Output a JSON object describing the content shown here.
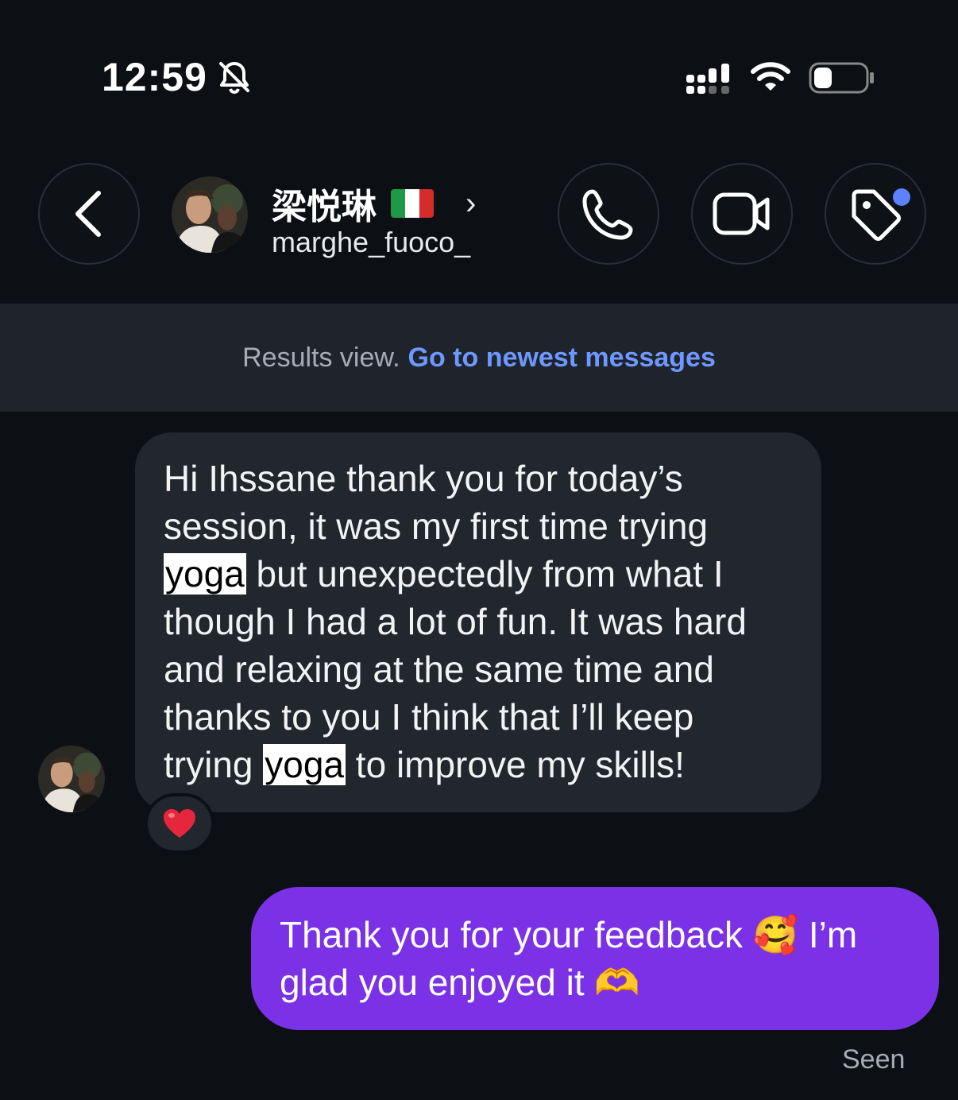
{
  "status_bar": {
    "time": "12:59",
    "icons": [
      "bell-slash-icon",
      "cellular-signal-icon",
      "wifi-icon",
      "battery-icon"
    ]
  },
  "header": {
    "contact_name": "梁悦琳",
    "username": "marghe_fuoco_",
    "flag": "italy-flag",
    "buttons": [
      "back-button",
      "call-button",
      "video-call-button",
      "tag-button"
    ],
    "accent_dot_color": "#5b82ff"
  },
  "banner": {
    "prefix": "Results view.",
    "link": "Go to newest messages",
    "link_color": "#6f98ff"
  },
  "messages": [
    {
      "direction": "incoming",
      "parts": [
        "Hi Ihssane thank you for today’s session, it was my first time trying ",
        "yoga",
        " but unexpectedly from what I though I had a lot of fun. It was hard and relaxing at the same time and thanks to you I think that I’ll keep trying ",
        "yoga",
        " to improve my skills!"
      ],
      "reaction": "heart"
    },
    {
      "direction": "outgoing",
      "text_a": "Thank you for your feedback ",
      "emoji_a": "🥰",
      "text_b": " I’m glad you enjoyed it ",
      "emoji_b": "🫶",
      "bubble_color": "#7b32e6"
    }
  ],
  "seen_label": "Seen"
}
